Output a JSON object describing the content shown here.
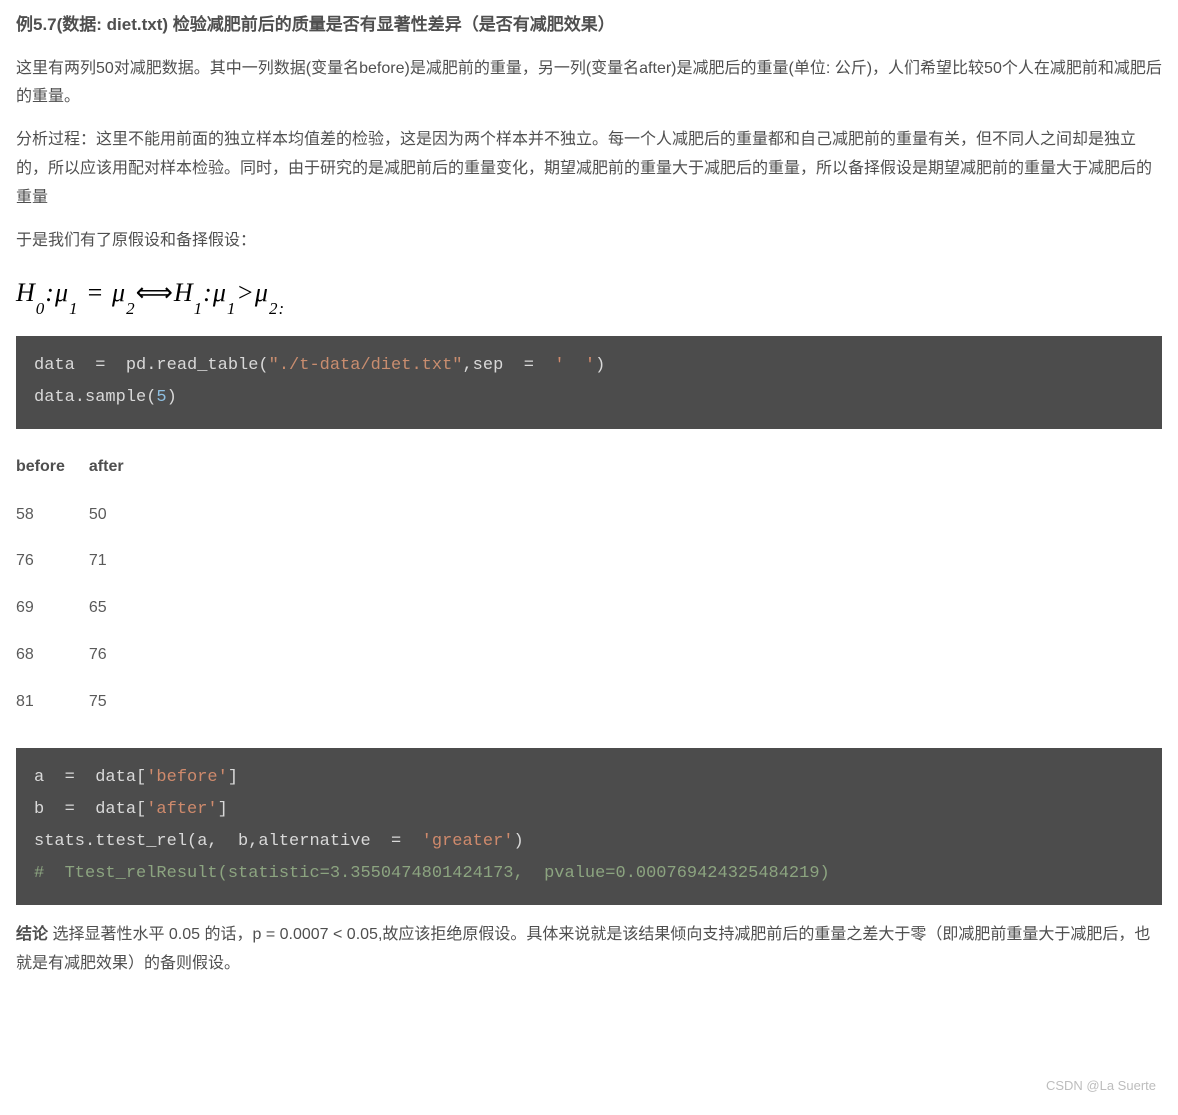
{
  "heading": "例5.7(数据: diet.txt) 检验减肥前后的质量是否有显著性差异（是否有减肥效果）",
  "para1": "这里有两列50对减肥数据。其中一列数据(变量名before)是减肥前的重量，另一列(变量名after)是减肥后的重量(单位: 公斤)，人们希望比较50个人在减肥前和减肥后的重量。",
  "para2": "分析过程：这里不能用前面的独立样本均值差的检验，这是因为两个样本并不独立。每一个人减肥后的重量都和自己减肥前的重量有关，但不同人之间却是独立的，所以应该用配对样本检验。同时，由于研究的是减肥前后的重量变化，期望减肥前的重量大于减肥后的重量，所以备择假设是期望减肥前的重量大于减肥后的重量",
  "para3": "于是我们有了原假设和备择假设：",
  "code1": {
    "line1_prefix": "data  =  pd.read_table(",
    "line1_str": "\"./t-data/diet.txt\"",
    "line1_mid": ",sep  =  ",
    "line1_sq": "'  '",
    "line1_suffix": ")",
    "line2_prefix": "data.sample(",
    "line2_num": "5",
    "line2_suffix": ")"
  },
  "table": {
    "headers": [
      "before",
      "after"
    ],
    "rows": [
      [
        "58",
        "50"
      ],
      [
        "76",
        "71"
      ],
      [
        "69",
        "65"
      ],
      [
        "68",
        "76"
      ],
      [
        "81",
        "75"
      ]
    ]
  },
  "code2": {
    "line1_prefix": "a  =  data[",
    "line1_str": "'before'",
    "line1_suffix": "]",
    "line2_prefix": "b  =  data[",
    "line2_str": "'after'",
    "line2_suffix": "]",
    "line3_prefix": "stats.ttest_rel(a,  b,alternative  =  ",
    "line3_str": "'greater'",
    "line3_suffix": ")",
    "line4": "#  Ttest_relResult(statistic=3.3550474801424173,  pvalue=0.000769424325484219)"
  },
  "conclusion_label": "结论",
  "conclusion_text": " 选择显著性水平 0.05 的话，p = 0.0007 < 0.05,故应该拒绝原假设。具体来说就是该结果倾向支持减肥前后的重量之差大于零（即减肥前重量大于减肥后，也就是有减肥效果）的备则假设。",
  "watermark": "CSDN @La Suerte"
}
